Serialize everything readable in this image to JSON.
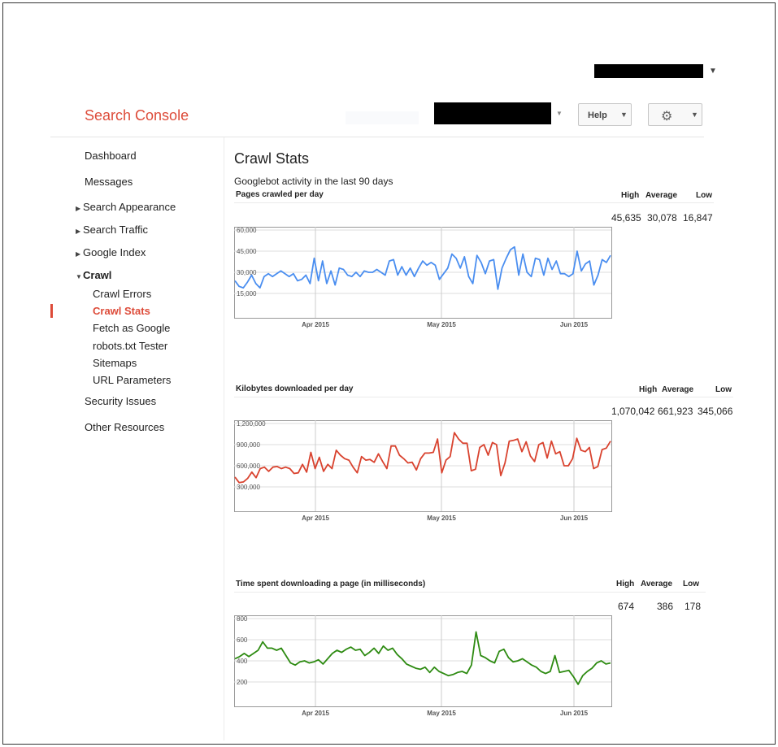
{
  "header": {
    "brand": "Search Console",
    "help_label": "Help",
    "settings_icon": "gear-icon"
  },
  "sidebar": {
    "items": [
      {
        "label": "Dashboard"
      },
      {
        "label": "Messages"
      },
      {
        "label": "Search Appearance"
      },
      {
        "label": "Search Traffic"
      },
      {
        "label": "Google Index"
      },
      {
        "label": "Crawl"
      },
      {
        "label": "Security Issues"
      },
      {
        "label": "Other Resources"
      }
    ],
    "crawl_sub": [
      {
        "label": "Crawl Errors"
      },
      {
        "label": "Crawl Stats"
      },
      {
        "label": "Fetch as Google"
      },
      {
        "label": "robots.txt Tester"
      },
      {
        "label": "Sitemaps"
      },
      {
        "label": "URL Parameters"
      }
    ]
  },
  "main": {
    "title": "Crawl Stats",
    "subtitle": "Googlebot activity in the last 90 days"
  },
  "chart_data": [
    {
      "type": "line",
      "title": "Pages crawled per day",
      "color": "#4a8ef0",
      "stats": {
        "high_label": "High",
        "avg_label": "Average",
        "low_label": "Low",
        "high": "45,635",
        "average": "30,078",
        "low": "16,847"
      },
      "yticks": [
        "60,000",
        "45,000",
        "30,000",
        "15,000"
      ],
      "ylim": [
        0,
        60000
      ],
      "xticks": [
        "Apr 2015",
        "May 2015",
        "Jun 2015"
      ],
      "values": [
        24000,
        20000,
        19000,
        23000,
        28000,
        22000,
        19000,
        27000,
        29000,
        27000,
        29000,
        31000,
        29000,
        27000,
        29000,
        24000,
        25000,
        28000,
        22000,
        40000,
        24000,
        38000,
        22000,
        31000,
        21000,
        33000,
        32000,
        28000,
        27000,
        30000,
        27000,
        31000,
        30000,
        30000,
        32000,
        30000,
        28000,
        38000,
        39000,
        28000,
        34000,
        28000,
        33000,
        27000,
        33000,
        38000,
        35000,
        37000,
        35000,
        25000,
        29000,
        33000,
        43000,
        40000,
        33000,
        41000,
        27000,
        22000,
        42000,
        37000,
        29000,
        38000,
        39000,
        18000,
        33000,
        40000,
        46000,
        48000,
        28000,
        43000,
        30000,
        27000,
        40000,
        39000,
        28000,
        40000,
        32000,
        38000,
        29000,
        29000,
        27000,
        29000,
        45000,
        31000,
        36000,
        38000,
        21000,
        28000,
        39000,
        37000,
        42000
      ]
    },
    {
      "type": "line",
      "title": "Kilobytes downloaded per day",
      "color": "#d9432f",
      "stats": {
        "high_label": "High",
        "avg_label": "Average",
        "low_label": "Low",
        "high": "1,070,042",
        "average": "661,923",
        "low": "345,066"
      },
      "yticks": [
        "1,200,000",
        "900,000",
        "600,000",
        "300,000"
      ],
      "ylim": [
        0,
        1200000
      ],
      "xticks": [
        "Apr 2015",
        "May 2015",
        "Jun 2015"
      ],
      "values": [
        440000,
        360000,
        370000,
        420000,
        510000,
        430000,
        560000,
        580000,
        520000,
        580000,
        590000,
        560000,
        580000,
        560000,
        490000,
        500000,
        620000,
        510000,
        790000,
        560000,
        720000,
        520000,
        620000,
        560000,
        820000,
        750000,
        700000,
        680000,
        580000,
        500000,
        730000,
        680000,
        690000,
        650000,
        770000,
        660000,
        560000,
        880000,
        880000,
        750000,
        700000,
        640000,
        650000,
        540000,
        700000,
        780000,
        780000,
        790000,
        980000,
        500000,
        680000,
        730000,
        1070000,
        980000,
        920000,
        920000,
        530000,
        550000,
        860000,
        900000,
        750000,
        930000,
        900000,
        460000,
        640000,
        950000,
        960000,
        980000,
        800000,
        940000,
        740000,
        660000,
        900000,
        930000,
        710000,
        950000,
        770000,
        800000,
        600000,
        600000,
        700000,
        990000,
        820000,
        800000,
        860000,
        560000,
        590000,
        830000,
        850000,
        950000
      ]
    },
    {
      "type": "line",
      "title": "Time spent downloading a page (in milliseconds)",
      "color": "#2e8b12",
      "stats": {
        "high_label": "High",
        "avg_label": "Average",
        "low_label": "Low",
        "high": "674",
        "average": "386",
        "low": "178"
      },
      "yticks": [
        "800",
        "600",
        "400",
        "200"
      ],
      "ylim": [
        0,
        800
      ],
      "xticks": [
        "Apr 2015",
        "May 2015",
        "Jun 2015"
      ],
      "values": [
        420,
        440,
        470,
        440,
        470,
        500,
        580,
        520,
        520,
        500,
        520,
        450,
        380,
        360,
        390,
        400,
        380,
        390,
        410,
        370,
        420,
        470,
        500,
        480,
        510,
        530,
        500,
        510,
        450,
        480,
        520,
        470,
        540,
        500,
        520,
        460,
        420,
        370,
        350,
        330,
        320,
        340,
        290,
        340,
        300,
        280,
        260,
        270,
        290,
        300,
        280,
        360,
        674,
        450,
        430,
        400,
        380,
        490,
        510,
        430,
        390,
        400,
        420,
        390,
        360,
        340,
        300,
        280,
        300,
        450,
        290,
        300,
        310,
        250,
        178,
        260,
        300,
        330,
        380,
        400,
        370,
        380
      ]
    }
  ]
}
